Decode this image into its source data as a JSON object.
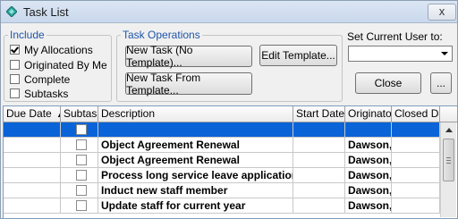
{
  "window": {
    "title": "Task List",
    "close_glyph": "x"
  },
  "include": {
    "legend": "Include",
    "options": [
      {
        "label": "My Allocations",
        "checked": true
      },
      {
        "label": "Originated By Me",
        "checked": false
      },
      {
        "label": "Complete",
        "checked": false
      },
      {
        "label": "Subtasks",
        "checked": false
      }
    ]
  },
  "operations": {
    "legend": "Task Operations",
    "new_no_template": "New Task (No Template)...",
    "edit_template": "Edit Template...",
    "new_from_template": "New Task From Template..."
  },
  "current_user": {
    "label": "Set Current User to:",
    "value": ""
  },
  "close_label": "Close",
  "ellipsis_label": "...",
  "grid": {
    "columns": [
      "Due Date",
      "Subtask",
      "Description",
      "Start Date",
      "Originator",
      "Closed Date"
    ],
    "sort_indicator": "▲",
    "rows": [
      {
        "due": "",
        "subtask": false,
        "description": "",
        "start": "",
        "originator": "",
        "closed": "",
        "selected": true
      },
      {
        "due": "",
        "subtask": false,
        "description": "Object Agreement Renewal",
        "start": "",
        "originator": "Dawson,",
        "closed": "",
        "selected": false
      },
      {
        "due": "",
        "subtask": false,
        "description": "Object Agreement Renewal",
        "start": "",
        "originator": "Dawson,",
        "closed": "",
        "selected": false
      },
      {
        "due": "",
        "subtask": false,
        "description": "Process long service leave application",
        "start": "",
        "originator": "Dawson,",
        "closed": "",
        "selected": false
      },
      {
        "due": "",
        "subtask": false,
        "description": "Induct new staff member",
        "start": "",
        "originator": "Dawson,",
        "closed": "",
        "selected": false
      },
      {
        "due": "",
        "subtask": false,
        "description": "Update staff for current year",
        "start": "",
        "originator": "Dawson,",
        "closed": "",
        "selected": false
      }
    ]
  },
  "colors": {
    "title_accent": "#1f55a8",
    "selection": "#0a64d8"
  },
  "icons": {
    "app": "task-list-diamond-icon",
    "sort": "sort-ascending-icon"
  }
}
